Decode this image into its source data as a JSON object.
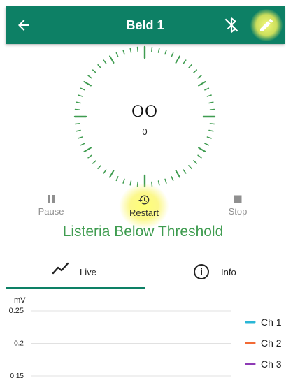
{
  "header": {
    "title": "Beld 1",
    "background": "#0d8065",
    "icons": {
      "back": "arrow-left-icon",
      "bluetooth": "bluetooth-disabled-icon",
      "edit": "pencil-icon"
    }
  },
  "gauge": {
    "value_text": "OO",
    "reading": "0",
    "tick_color": "#3f9c50"
  },
  "controls": {
    "pause_label": "Pause",
    "restart_label": "Restart",
    "stop_label": "Stop"
  },
  "status": {
    "text": "Listeria Below Threshold",
    "color": "#3f9c50"
  },
  "tabs": [
    {
      "label": "Live",
      "icon": "trend-line-icon",
      "selected": true
    },
    {
      "label": "Info",
      "icon": "info-icon",
      "selected": false
    }
  ],
  "chart_data": {
    "type": "line",
    "ylabel": "mV",
    "y_ticks": [
      "0.25",
      "0.2",
      "0.15"
    ],
    "ylim": [
      0.15,
      0.25
    ],
    "grid": true,
    "legend_position": "right",
    "series": [
      {
        "name": "Ch 1",
        "color": "#29b6d6",
        "values": []
      },
      {
        "name": "Ch 2",
        "color": "#f26a35",
        "values": []
      },
      {
        "name": "Ch 3",
        "color": "#8e3ab5",
        "values": []
      }
    ]
  }
}
